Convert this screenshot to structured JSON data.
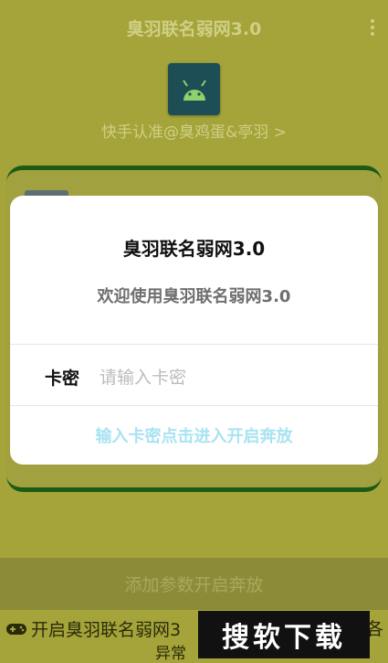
{
  "appbar": {
    "title": "臭羽联名弱网3.0"
  },
  "header": {
    "author": "快手认准@臭鸡蛋&亭羽 >"
  },
  "bottom": {
    "button_label": "添加参数开启奔放",
    "footer_line1": "开启臭羽联名弱网3",
    "footer_line2": "异常",
    "footer_tail": "各"
  },
  "watermark": {
    "text": "搜软下载"
  },
  "dialog": {
    "title": "臭羽联名弱网3.0",
    "message": "欢迎使用臭羽联名弱网3.0",
    "field_label": "卡密",
    "field_value": "",
    "field_placeholder": "请输入卡密",
    "action_label": "输入卡密点击进入开启奔放"
  },
  "icons": {
    "app": "android-icon",
    "menu": "more-vert-icon",
    "footer": "gamepad-icon"
  },
  "colors": {
    "background": "#a4a43a",
    "dialog_action": "#a9e3f2",
    "card_border": "#1e5a14",
    "app_icon_bg": "#1e4e55"
  }
}
